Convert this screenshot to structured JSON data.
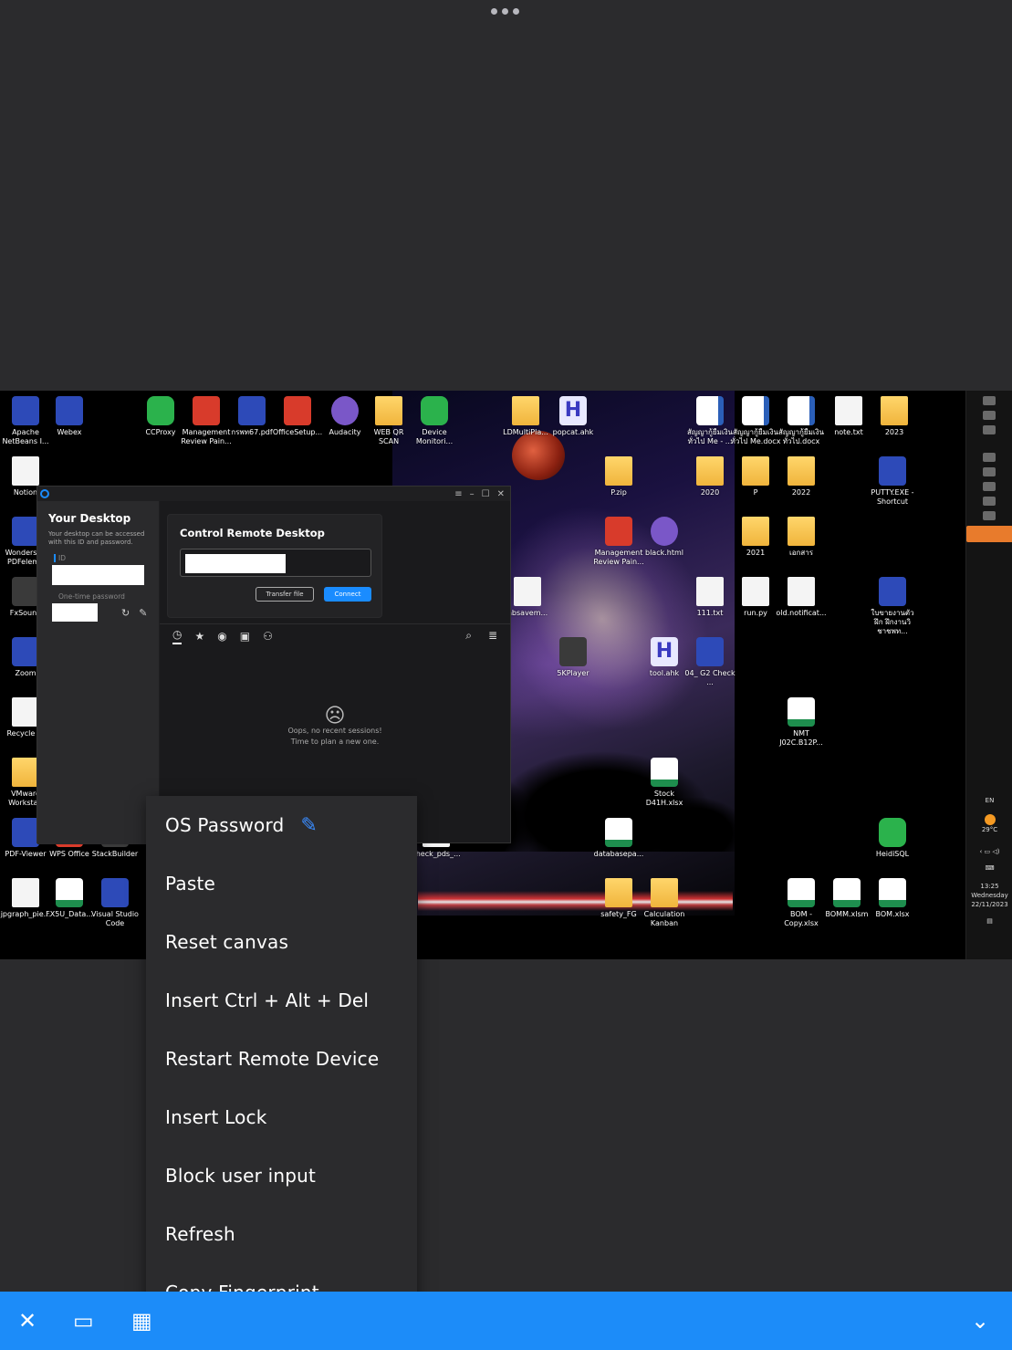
{
  "top": {
    "handle_icon": "more-dots-icon"
  },
  "desktop": {
    "icons": [
      {
        "label": "Apache NetBeans I...",
        "kind": "blue"
      },
      {
        "label": "Webex",
        "kind": "blue"
      },
      {
        "label": "CCProxy",
        "kind": "green"
      },
      {
        "label": "Management Review Pain...",
        "kind": "red"
      },
      {
        "label": "กรพท67.pdf",
        "kind": "blue"
      },
      {
        "label": "OfficeSetup...",
        "kind": "red"
      },
      {
        "label": "Audacity",
        "kind": "purple"
      },
      {
        "label": "WEB QR SCAN",
        "kind": "folder"
      },
      {
        "label": "Device Monitori...",
        "kind": "green"
      },
      {
        "label": "LDMultiPla...",
        "kind": "folder"
      },
      {
        "label": "popcat.ahk",
        "kind": "ahk"
      },
      {
        "label": "สัญญากู้ยืมเงิน ทั่วไป Me - ...",
        "kind": "word"
      },
      {
        "label": "สัญญากู้ยืมเงิน ทั่วไป Me.docx",
        "kind": "word"
      },
      {
        "label": "สัญญากู้ยืมเงิน ทั่วไป.docx",
        "kind": "word"
      },
      {
        "label": "note.txt",
        "kind": "file"
      },
      {
        "label": "2023",
        "kind": "folder"
      },
      {
        "label": "Notion",
        "kind": "file"
      },
      {
        "label": "P.zip",
        "kind": "folder"
      },
      {
        "label": "2020",
        "kind": "folder"
      },
      {
        "label": "P",
        "kind": "folder"
      },
      {
        "label": "2022",
        "kind": "folder"
      },
      {
        "label": "PUTTY.EXE - Shortcut",
        "kind": "blue"
      },
      {
        "label": "Wondersha PDFeleme",
        "kind": "blue"
      },
      {
        "label": "Management Review Pain...",
        "kind": "red"
      },
      {
        "label": "black.html",
        "kind": "purple"
      },
      {
        "label": "2021",
        "kind": "folder"
      },
      {
        "label": "เอกสาร",
        "kind": "folder"
      },
      {
        "label": "FxSound",
        "kind": "dark"
      },
      {
        "label": "nbsavem...",
        "kind": "file"
      },
      {
        "label": "111.txt",
        "kind": "file"
      },
      {
        "label": "run.py",
        "kind": "file"
      },
      {
        "label": "old.notificat...",
        "kind": "file"
      },
      {
        "label": "ใบขายงานตัวฝึก ฝึกงานวิชาชพท...",
        "kind": "blue"
      },
      {
        "label": "Zoom",
        "kind": "blue"
      },
      {
        "label": "5KPlayer",
        "kind": "dark"
      },
      {
        "label": "tool.ahk",
        "kind": "ahk"
      },
      {
        "label": "04_ G2 Check ...",
        "kind": "blue"
      },
      {
        "label": "Recycle Bi",
        "kind": "file"
      },
      {
        "label": "NMT J02C.B12P...",
        "kind": "excel"
      },
      {
        "label": "VMware Workstati",
        "kind": "folder"
      },
      {
        "label": "Stock D41H.xlsx",
        "kind": "excel"
      },
      {
        "label": "PDF-Viewer",
        "kind": "blue"
      },
      {
        "label": "WPS Office",
        "kind": "red"
      },
      {
        "label": "StackBuilder",
        "kind": "dark"
      },
      {
        "label": "check_pds_...",
        "kind": "file"
      },
      {
        "label": "databasepa...",
        "kind": "excel"
      },
      {
        "label": "HeidiSQL",
        "kind": "green"
      },
      {
        "label": "jpgraph_pie...",
        "kind": "file"
      },
      {
        "label": "FX5U_Data...",
        "kind": "excel"
      },
      {
        "label": "Visual Studio Code",
        "kind": "blue"
      },
      {
        "label": "safety_FG",
        "kind": "folder"
      },
      {
        "label": "Calculation Kanban",
        "kind": "folder"
      },
      {
        "label": "BOM - Copy.xlsx",
        "kind": "excel"
      },
      {
        "label": "BOMM.xlsm",
        "kind": "excel"
      },
      {
        "label": "BOM.xlsx",
        "kind": "excel"
      }
    ]
  },
  "app": {
    "left": {
      "title": "Your Desktop",
      "desc": "Your desktop can be accessed with this ID and password.",
      "id_label": "ID",
      "otp_label": "One-time password"
    },
    "control": {
      "title": "Control Remote Desktop",
      "transfer_label": "Transfer file",
      "connect_label": "Connect"
    },
    "empty": {
      "line1": "Oops, no recent sessions!",
      "line2": "Time to plan a new one."
    }
  },
  "taskbar": {
    "lang": "EN",
    "temp": "29°C",
    "time": "13:25",
    "day": "Wednesday",
    "date": "22/11/2023"
  },
  "menu": {
    "items": [
      "OS Password",
      "Paste",
      "Reset canvas",
      "Insert Ctrl + Alt + Del",
      "Restart Remote Device",
      "Insert Lock",
      "Block user input",
      "Refresh",
      "Copy Fingerprint"
    ]
  },
  "toolbar": {
    "accent": "#1c8cf9"
  }
}
